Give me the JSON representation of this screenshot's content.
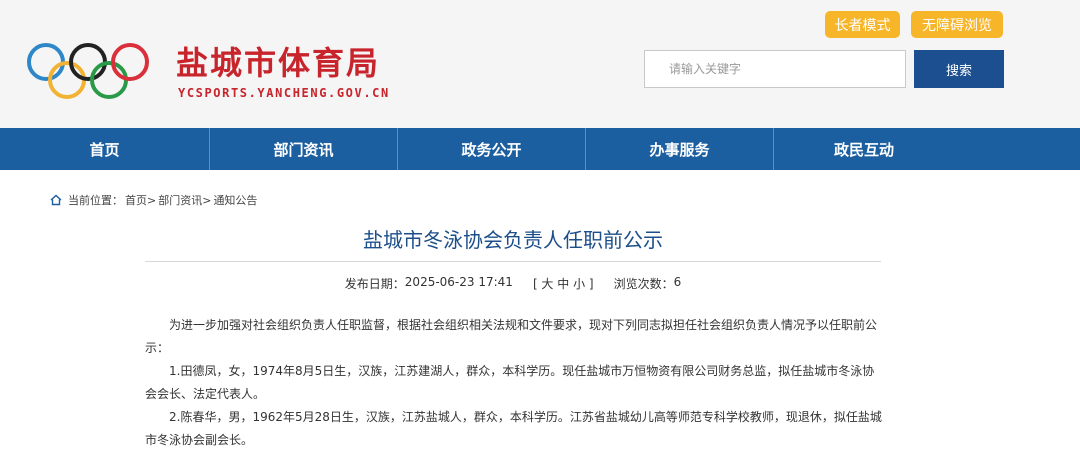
{
  "header": {
    "site_title": "盐城市体育局",
    "site_domain": "YCSPORTS.YANCHENG.GOV.CN",
    "elder_mode": "长者模式",
    "accessible_mode": "无障碍浏览",
    "search_placeholder": "请输入关键字",
    "search_button": "搜索",
    "ring_colors": [
      "#2e88c8",
      "#f2b233",
      "#222222",
      "#2a9a48",
      "#d9303b"
    ]
  },
  "nav": {
    "items": [
      "首页",
      "部门资讯",
      "政务公开",
      "办事服务",
      "政民互动"
    ]
  },
  "breadcrumb": {
    "prefix": "当前位置：",
    "items": [
      "首页>",
      "部门资讯>",
      "通知公告"
    ]
  },
  "article": {
    "title": "盐城市冬泳协会负责人任职前公示",
    "publish_label": "发布日期：",
    "publish_date": "2025-06-23 17:41",
    "font_size_control": "[ 大 中 小 ]",
    "views_label": "浏览次数：",
    "views": "6",
    "paragraphs": [
      "为进一步加强对社会组织负责人任职监督，根据社会组织相关法规和文件要求，现对下列同志拟担任社会组织负责人情况予以任职前公示：",
      "1.田德凤，女，1974年8月5日生，汉族，江苏建湖人，群众，本科学历。现任盐城市万恒物资有限公司财务总监，拟任盐城市冬泳协会会长、法定代表人。",
      "2.陈春华，男，1962年5月28日生，汉族，江苏盐城人，群众，本科学历。江苏省盐城幼儿高等师范专科学校教师，现退休，拟任盐城市冬泳协会副会长。"
    ]
  }
}
